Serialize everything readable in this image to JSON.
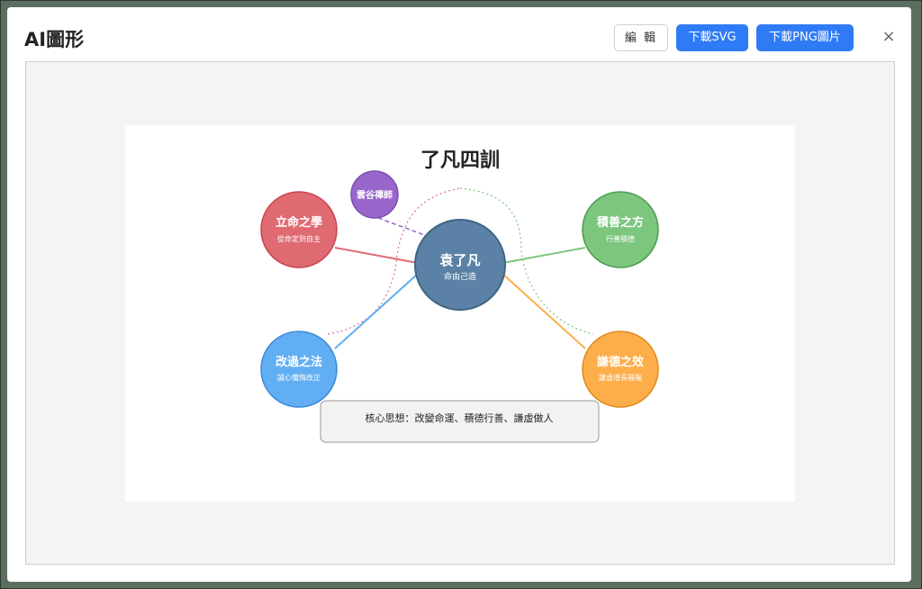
{
  "header": {
    "title": "AI圖形",
    "edit_label": "編 輯",
    "download_svg_label": "下載SVG",
    "download_png_label": "下載PNG圖片",
    "close_symbol": "×"
  },
  "diagram": {
    "title": "了凡四訓",
    "center": {
      "label": "袁了凡",
      "sublabel": "命由己造",
      "color": "#5b82a6"
    },
    "small_node": {
      "label": "雲谷禪師",
      "color": "#9966cc"
    },
    "nodes": [
      {
        "label": "立命之學",
        "sublabel": "從命定到自主",
        "color": "#e06a72"
      },
      {
        "label": "積善之方",
        "sublabel": "行善積德",
        "color": "#7dc67e"
      },
      {
        "label": "改過之法",
        "sublabel": "誠心懺悔改正",
        "color": "#62aef2"
      },
      {
        "label": "謙德之效",
        "sublabel": "謙虛增長福報",
        "color": "#fdae4b"
      }
    ],
    "core_box": "核心思想：改變命運、積德行善、謙虛做人"
  }
}
